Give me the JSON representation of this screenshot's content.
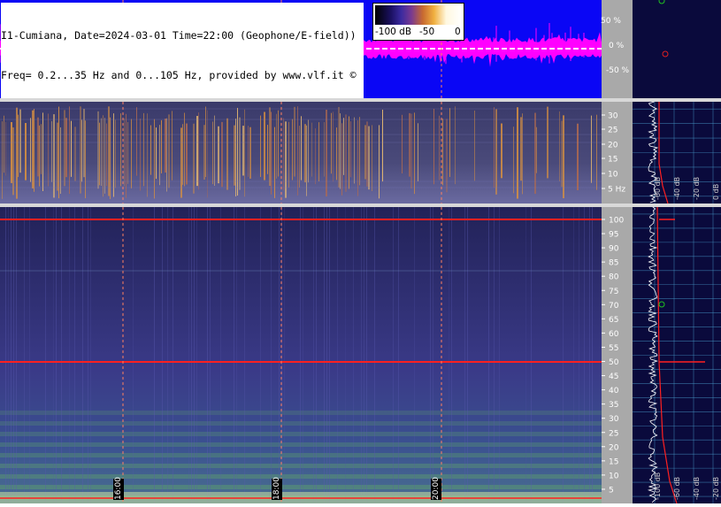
{
  "header": {
    "line1": "I1-Cumiana, Date=2024-03-01 Time=22:00 (Geophone/E-field))",
    "line2": "Freq= 0.2...35 Hz and 0...105 Hz, provided by www.vlf.it ©"
  },
  "colorbar": {
    "labels": [
      "-100 dB",
      "-50",
      "0"
    ]
  },
  "colors": {
    "wave_bg": "#0a06f5",
    "wave_trace": "#ff00ff",
    "marker_line": "#ff2020",
    "side_bg": "#0a0a3c",
    "grid": "#4aa0d0"
  },
  "wave_axis": {
    "labels": [
      "50 %",
      "0 %",
      "-50 %"
    ]
  },
  "time_markers": [
    "16:00",
    "18:00",
    "20:00"
  ],
  "chart_data": [
    {
      "type": "heatmap",
      "title": "",
      "xlabel": "",
      "ylabel": "",
      "ylim": [
        0.2,
        35
      ],
      "yticks": [
        "30",
        "25",
        "20",
        "15",
        "10",
        "5 Hz"
      ],
      "time_markers": [
        "16:00",
        "18:00",
        "20:00"
      ]
    },
    {
      "type": "heatmap",
      "title": "",
      "xlabel": "",
      "ylabel": "",
      "ylim": [
        0,
        105
      ],
      "yticks": [
        "100",
        "95",
        "90",
        "85",
        "80",
        "75",
        "70",
        "65",
        "60",
        "55",
        "50",
        "45",
        "40",
        "35",
        "30",
        "25",
        "20",
        "15",
        "10",
        "5"
      ],
      "lines_hz": [
        100,
        50
      ]
    }
  ],
  "side_panel": {
    "db_labels_top": [
      "-60 dB",
      "-40 dB",
      "-20 dB",
      "0 dB"
    ],
    "db_labels_bottom": [
      "-100 dB",
      "-60 dB",
      "-40 dB",
      "-20 dB"
    ]
  }
}
